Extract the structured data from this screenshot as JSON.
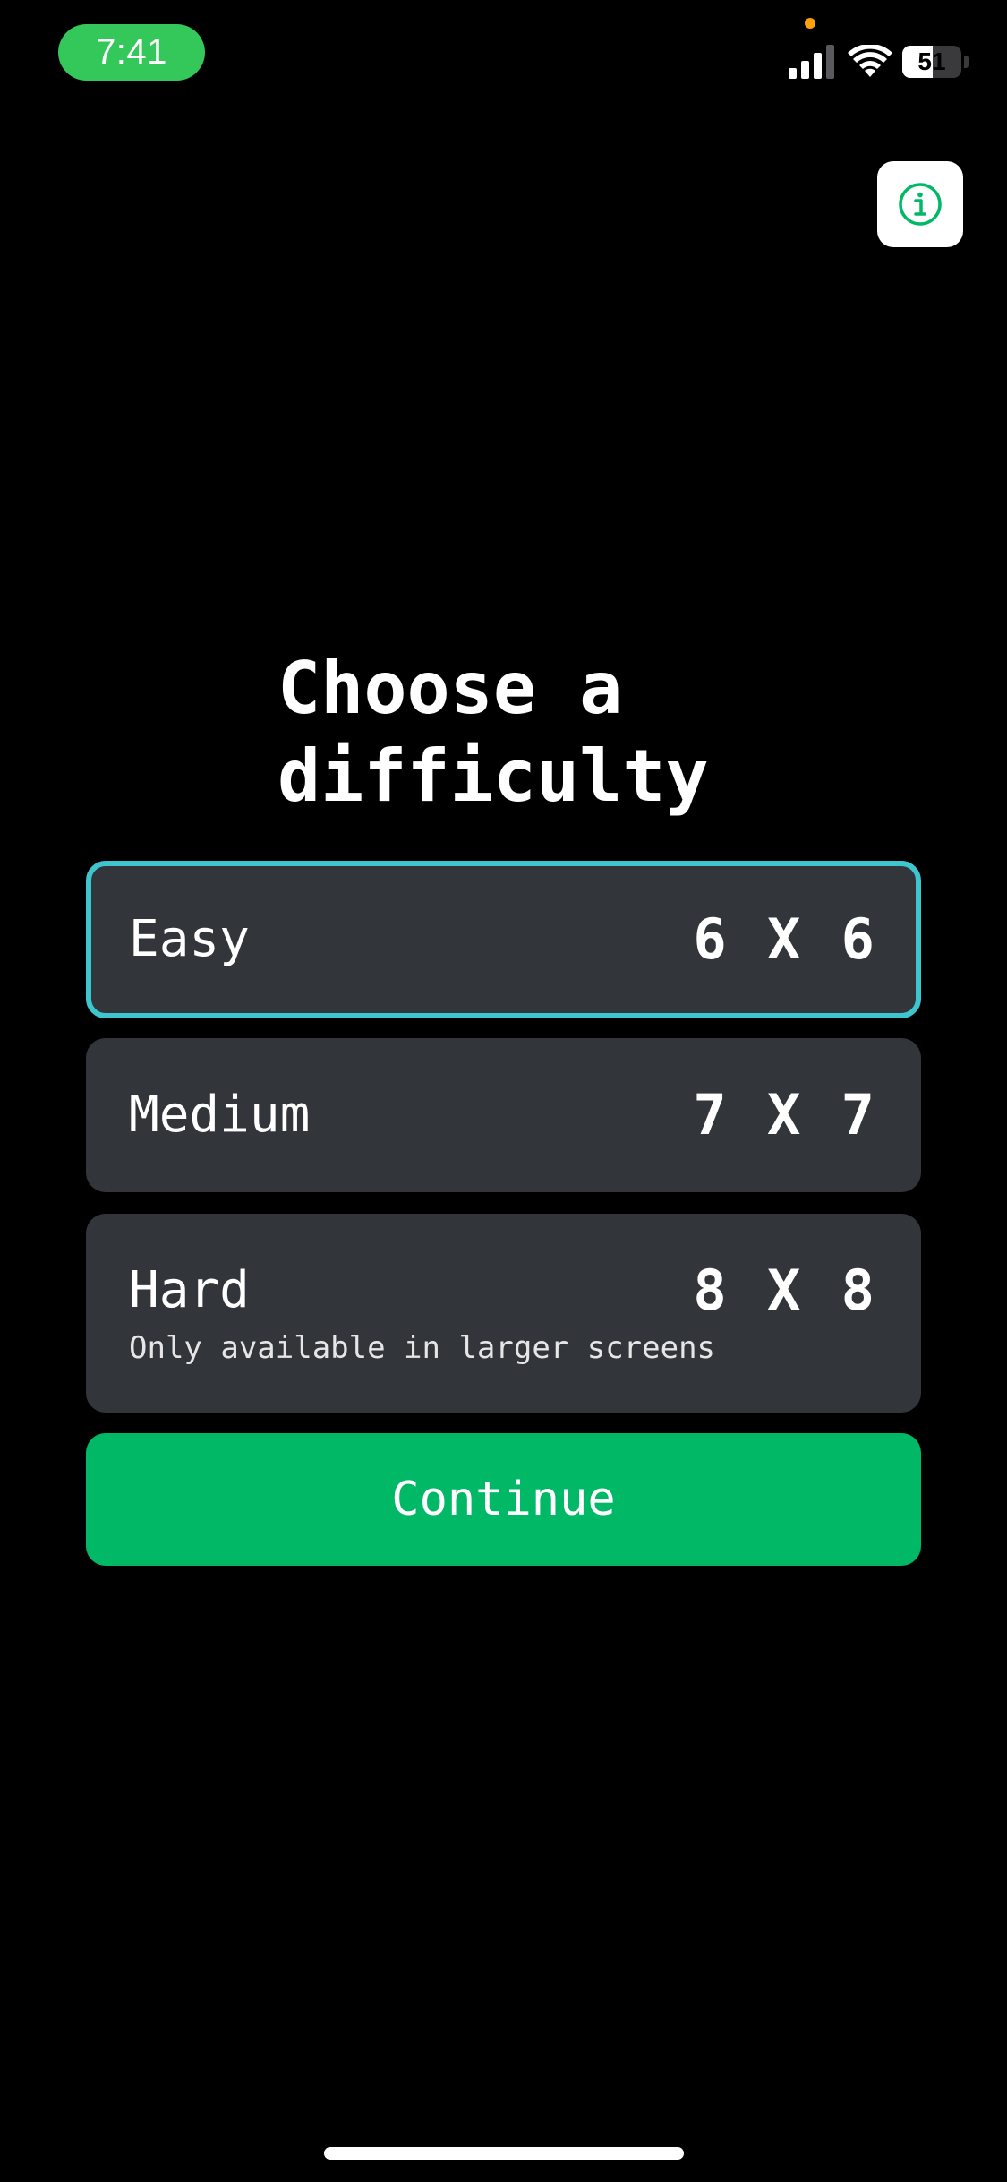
{
  "status_bar": {
    "time": "7:41",
    "battery_level": "51",
    "battery_fraction": 0.51,
    "icons": [
      "cellular-signal-icon",
      "wifi-icon",
      "battery-icon"
    ]
  },
  "info_button": {
    "icon": "info-icon"
  },
  "title": "Choose a\ndifficulty",
  "options": [
    {
      "name": "Easy",
      "size": "6 X 6",
      "note": "",
      "selected": true
    },
    {
      "name": "Medium",
      "size": "7 X 7",
      "note": "",
      "selected": false
    },
    {
      "name": "Hard",
      "size": "8 X 8",
      "note": "Only available in larger screens",
      "selected": false
    }
  ],
  "continue_label": "Continue",
  "colors": {
    "background": "#000000",
    "card": "#32363b",
    "selected_border": "#3ec6cf",
    "primary_button": "#00b865",
    "time_pill": "#34c759",
    "info_icon": "#00b865"
  }
}
